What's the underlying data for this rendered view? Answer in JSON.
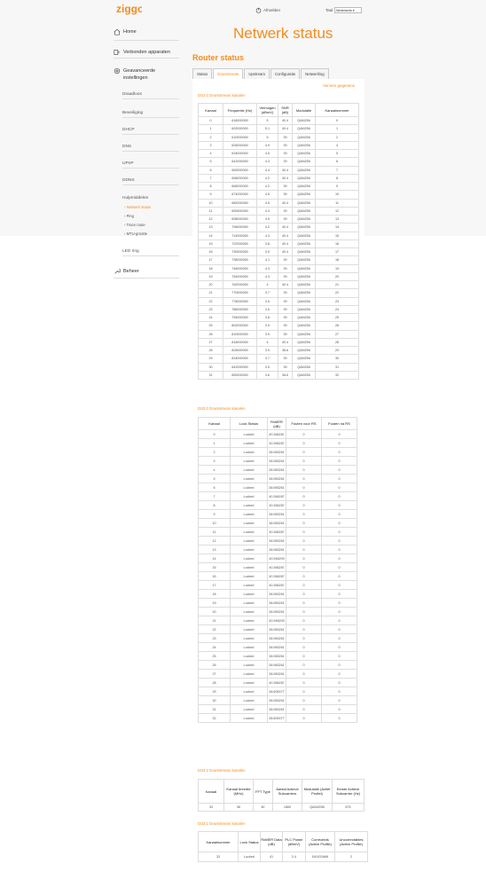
{
  "header": {
    "logo_text": "ziggo",
    "logout_label": "Afmelden",
    "lang_label": "Taal",
    "lang_value": "Nederlands"
  },
  "page": {
    "title": "Netwerk status",
    "router_title": "Router status",
    "refresh_label": "Ververs gegevens"
  },
  "sidebar": {
    "home": "Home",
    "devices": "Verbonden apparaten",
    "advanced": "Geavanceerde instellingen",
    "subs": [
      "Draadloos",
      "Beveiliging",
      "DHCP",
      "DNS",
      "UPnP",
      "DDNS",
      "Hulpmiddelen"
    ],
    "tools": [
      "Netwerk status",
      "Ping",
      "Trace route",
      "MTU-grootte"
    ],
    "led": "LED ring",
    "admin": "Beheer"
  },
  "tabs": [
    "Status",
    "Downstream",
    "Upstream",
    "Configuratie",
    "Netwerklog"
  ],
  "ds30": {
    "title": "DS3.0 Downstream kanalen",
    "headers": [
      "Kanaal",
      "Frequentie (Hz)",
      "Vermogen (dBmV)",
      "SNR (dB)",
      "Modulatie",
      "Kanaalnummer"
    ],
    "rows": [
      [
        "0",
        "618000000",
        "5",
        "40.4",
        "QAM256",
        "0"
      ],
      [
        "1",
        "602000000",
        "5.1",
        "40.4",
        "QAM256",
        "1"
      ],
      [
        "2",
        "610000000",
        "5",
        "39",
        "QAM256",
        "2"
      ],
      [
        "3",
        "626000000",
        "4.9",
        "39",
        "QAM256",
        "4"
      ],
      [
        "4",
        "634000000",
        "4.5",
        "39",
        "QAM256",
        "5"
      ],
      [
        "5",
        "642000000",
        "4.3",
        "39",
        "QAM256",
        "6"
      ],
      [
        "6",
        "650000000",
        "4.4",
        "40.4",
        "QAM256",
        "7"
      ],
      [
        "7",
        "658000000",
        "4.2",
        "40.4",
        "QAM256",
        "8"
      ],
      [
        "8",
        "666000000",
        "4.2",
        "39",
        "QAM256",
        "9"
      ],
      [
        "9",
        "674000000",
        "4.5",
        "39",
        "QAM256",
        "10"
      ],
      [
        "10",
        "682000000",
        "4.5",
        "40.4",
        "QAM256",
        "11"
      ],
      [
        "11",
        "690000000",
        "4.3",
        "39",
        "QAM256",
        "12"
      ],
      [
        "12",
        "698000000",
        "4.5",
        "39",
        "QAM256",
        "13"
      ],
      [
        "13",
        "706000000",
        "4.2",
        "40.4",
        "QAM256",
        "14"
      ],
      [
        "14",
        "714000000",
        "4.3",
        "40.4",
        "QAM256",
        "15"
      ],
      [
        "15",
        "722000000",
        "3.8",
        "40.4",
        "QAM256",
        "16"
      ],
      [
        "16",
        "730000000",
        "3.9",
        "40.4",
        "QAM256",
        "17"
      ],
      [
        "17",
        "738000000",
        "4.1",
        "39",
        "QAM256",
        "18"
      ],
      [
        "18",
        "746000000",
        "4.3",
        "39",
        "QAM256",
        "19"
      ],
      [
        "19",
        "754000000",
        "4.3",
        "39",
        "QAM256",
        "20"
      ],
      [
        "20",
        "762000000",
        "4",
        "40.4",
        "QAM256",
        "21"
      ],
      [
        "21",
        "770000000",
        "3.7",
        "39",
        "QAM256",
        "22"
      ],
      [
        "22",
        "778000000",
        "3.5",
        "39",
        "QAM256",
        "23"
      ],
      [
        "23",
        "786000000",
        "3.5",
        "39",
        "QAM256",
        "24"
      ],
      [
        "24",
        "794000000",
        "3.8",
        "39",
        "QAM256",
        "25"
      ],
      [
        "25",
        "802000000",
        "3.9",
        "39",
        "QAM256",
        "26"
      ],
      [
        "26",
        "810000000",
        "3.9",
        "39",
        "QAM256",
        "27"
      ],
      [
        "27",
        "818000000",
        "4",
        "40.4",
        "QAM256",
        "28"
      ],
      [
        "28",
        "826000000",
        "3.9",
        "38.6",
        "QAM256",
        "29"
      ],
      [
        "29",
        "834000000",
        "3.7",
        "39",
        "QAM256",
        "30"
      ],
      [
        "30",
        "842000000",
        "3.5",
        "39",
        "QAM256",
        "31"
      ],
      [
        "31",
        "850000000",
        "3.6",
        "38.6",
        "QAM256",
        "32"
      ]
    ]
  },
  "ds30_lock": {
    "title": "DS3.0 Downstream kanalen",
    "headers": [
      "Kanaal",
      "Lock Status",
      "RxMER (dB)",
      "Fouten voor RS",
      "Fouten na RS"
    ],
    "rows": [
      [
        "0",
        "Locked",
        "40.366287",
        "0",
        "0"
      ],
      [
        "1",
        "Locked",
        "40.366287",
        "0",
        "0"
      ],
      [
        "2",
        "Locked",
        "38.983261",
        "0",
        "0"
      ],
      [
        "3",
        "Locked",
        "38.983261",
        "0",
        "0"
      ],
      [
        "4",
        "Locked",
        "38.983261",
        "0",
        "0"
      ],
      [
        "5",
        "Locked",
        "38.983261",
        "0",
        "0"
      ],
      [
        "6",
        "Locked",
        "38.983261",
        "0",
        "0"
      ],
      [
        "7",
        "Locked",
        "40.366287",
        "0",
        "0"
      ],
      [
        "8",
        "Locked",
        "40.366287",
        "0",
        "0"
      ],
      [
        "9",
        "Locked",
        "38.983261",
        "0",
        "0"
      ],
      [
        "10",
        "Locked",
        "38.983261",
        "0",
        "0"
      ],
      [
        "11",
        "Locked",
        "40.366287",
        "0",
        "0"
      ],
      [
        "12",
        "Locked",
        "38.983261",
        "0",
        "0"
      ],
      [
        "13",
        "Locked",
        "38.983261",
        "0",
        "0"
      ],
      [
        "14",
        "Locked",
        "40.946209",
        "0",
        "0"
      ],
      [
        "15",
        "Locked",
        "40.366287",
        "0",
        "0"
      ],
      [
        "16",
        "Locked",
        "40.366287",
        "0",
        "0"
      ],
      [
        "17",
        "Locked",
        "40.366287",
        "0",
        "0"
      ],
      [
        "18",
        "Locked",
        "38.983261",
        "0",
        "0"
      ],
      [
        "19",
        "Locked",
        "38.983261",
        "0",
        "0"
      ],
      [
        "20",
        "Locked",
        "38.983261",
        "0",
        "0"
      ],
      [
        "21",
        "Locked",
        "40.946209",
        "0",
        "0"
      ],
      [
        "22",
        "Locked",
        "38.983261",
        "0",
        "0"
      ],
      [
        "23",
        "Locked",
        "38.983261",
        "0",
        "0"
      ],
      [
        "24",
        "Locked",
        "38.983261",
        "0",
        "0"
      ],
      [
        "25",
        "Locked",
        "38.983261",
        "0",
        "0"
      ],
      [
        "26",
        "Locked",
        "38.983261",
        "0",
        "0"
      ],
      [
        "27",
        "Locked",
        "38.983261",
        "0",
        "0"
      ],
      [
        "28",
        "Locked",
        "40.366287",
        "0",
        "0"
      ],
      [
        "29",
        "Locked",
        "38.605377",
        "0",
        "0"
      ],
      [
        "30",
        "Locked",
        "38.983261",
        "0",
        "0"
      ],
      [
        "31",
        "Locked",
        "38.983261",
        "0",
        "0"
      ],
      [
        "32",
        "Locked",
        "38.605377",
        "0",
        "0"
      ]
    ]
  },
  "ds31": {
    "title": "DS3.1 Downstream kanalen",
    "headers": [
      "Kanaal",
      "Kanaal breedte (MHz)",
      "FFT Type",
      "Aantal Actieve Subcarriers",
      "Modulatie (Actief Profiel)",
      "Eerste Actieve Subcarrier (Hz)"
    ],
    "row": [
      "33",
      "96",
      "4K",
      "1860",
      "QAM4096",
      "875"
    ]
  },
  "ds31_lock": {
    "title": "DS3.1 Downstream kanalen",
    "headers": [
      "Kanaalnummer",
      "Lock Status",
      "RxMER Data (dB)",
      "PLC Power (dBmV)",
      "Correcteds (Active Profile)",
      "Uncorrectables (Active Profile)"
    ],
    "row": [
      "33",
      "Locked",
      "41",
      "2.4",
      "541931666",
      "2"
    ]
  }
}
